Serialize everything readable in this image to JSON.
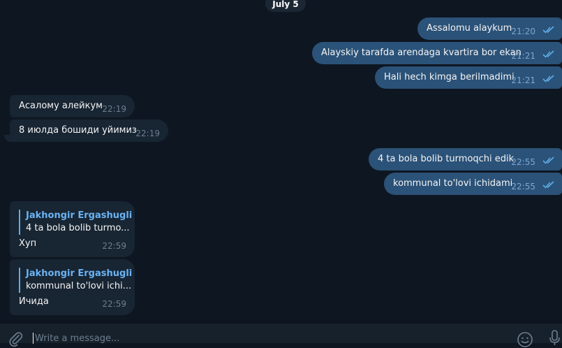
{
  "date_separator": "July 5",
  "outgoing_1": [
    {
      "text": "Assalomu alaykum",
      "time": "21:20"
    },
    {
      "text": "Alayskiy tarafda arendaga kvartira bor ekan",
      "time": "21:21"
    },
    {
      "text": "Hali hech kimga berilmadimi",
      "time": "21:21"
    }
  ],
  "incoming_1": [
    {
      "text": "Асалому алейкум",
      "time": "22:19"
    },
    {
      "text": "8 июлда бошиди уйимиз",
      "time": "22:19"
    }
  ],
  "outgoing_2": [
    {
      "text": "4 ta bola bolib turmoqchi edik",
      "time": "22:55"
    },
    {
      "text": "kommunal to'lovi ichidami",
      "time": "22:55"
    }
  ],
  "replies": [
    {
      "quote_author": "Jakhongir Ergashugli",
      "quote_text": "4 ta bola bolib turmo...",
      "text": "Хуп",
      "time": "22:59"
    },
    {
      "quote_author": "Jakhongir Ergashugli",
      "quote_text": "kommunal to'lovi ichi...",
      "text": "Ичида",
      "time": "22:59"
    }
  ],
  "composer": {
    "placeholder": "Write a message..."
  },
  "icons": {
    "read_receipt": "double-check-icon",
    "attach": "paperclip-icon",
    "emoji": "emoji-icon",
    "voice": "microphone-icon"
  },
  "colors": {
    "background": "#0e1621",
    "outgoing_bubble": "#2b5278",
    "incoming_bubble": "#182533",
    "accent": "#6ab3f3"
  }
}
